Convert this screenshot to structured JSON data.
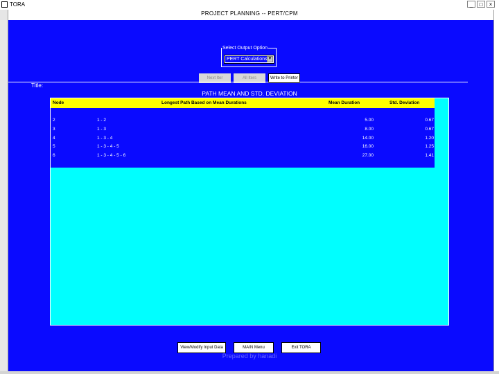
{
  "window": {
    "app_title": "TORA",
    "min_label": "_",
    "max_label": "□",
    "close_label": "×"
  },
  "header": {
    "title": "PROJECT PLANNING -- PERT/CPM"
  },
  "output_option": {
    "legend": "Select Output Option",
    "selected": "PERT Calculations",
    "arrow": "▼"
  },
  "toolbar": {
    "next_label": "Next Iter",
    "all_label": "All Iters",
    "write_label": "Write to Printer"
  },
  "title_label": "Title:",
  "table": {
    "title": "PATH MEAN AND STD. DEVIATION",
    "headers": {
      "node": "Node",
      "path": "Longest Path Based on Mean Durations",
      "mean": "Mean Duration",
      "std": "Std. Deviation"
    },
    "rows": [
      {
        "node": "2",
        "path": "1 - 2",
        "mean": "5.00",
        "std": "0.67"
      },
      {
        "node": "3",
        "path": "1 - 3",
        "mean": "8.00",
        "std": "0.67"
      },
      {
        "node": "4",
        "path": "1 - 3 - 4",
        "mean": "14.00",
        "std": "1.20"
      },
      {
        "node": "5",
        "path": "1 - 3 - 4 - 5",
        "mean": "16.00",
        "std": "1.25"
      },
      {
        "node": "6",
        "path": "1 - 3 - 4 - 5 - 6",
        "mean": "27.00",
        "std": "1.41"
      }
    ]
  },
  "bottom_buttons": {
    "view_input": "View/Modify Input Data",
    "main_menu": "MAIN Menu",
    "exit": "Exit TORA"
  },
  "watermark": "Prepared by hanadi"
}
